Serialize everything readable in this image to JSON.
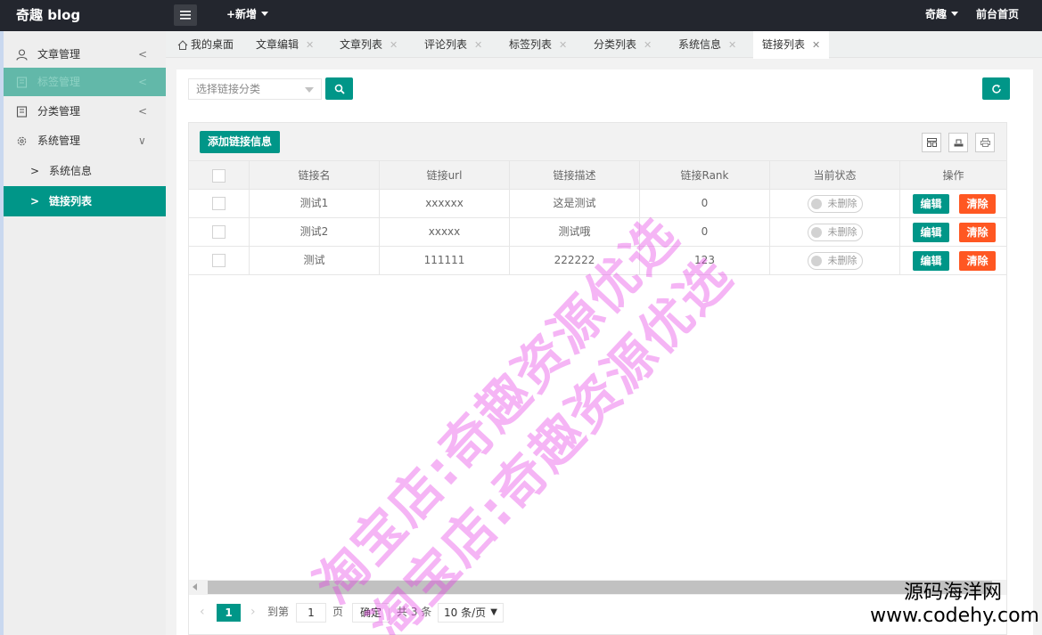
{
  "header": {
    "logo": "奇趣 blog",
    "add_new": "+新增",
    "user": "奇趣",
    "frontpage": "前台首页"
  },
  "sidebar": {
    "items": [
      {
        "label": "文章管理",
        "icon": "user-icon"
      },
      {
        "label": "标签管理",
        "icon": "book-icon"
      },
      {
        "label": "分类管理",
        "icon": "book-icon"
      },
      {
        "label": "系统管理",
        "icon": "gear-icon"
      }
    ],
    "sub_items": [
      {
        "label": "系统信息"
      },
      {
        "label": "链接列表"
      }
    ]
  },
  "tabs": [
    {
      "label": "我的桌面"
    },
    {
      "label": "文章编辑"
    },
    {
      "label": "文章列表"
    },
    {
      "label": "评论列表"
    },
    {
      "label": "标签列表"
    },
    {
      "label": "分类列表"
    },
    {
      "label": "系统信息"
    },
    {
      "label": "链接列表"
    }
  ],
  "filter": {
    "category_placeholder": "选择链接分类"
  },
  "toolbar": {
    "add_label": "添加链接信息"
  },
  "table": {
    "columns": [
      "链接名",
      "链接url",
      "链接描述",
      "链接Rank",
      "当前状态",
      "操作"
    ],
    "rows": [
      {
        "name": "测试1",
        "url": "xxxxxx",
        "desc": "这是测试",
        "rank": "0",
        "status": "未删除"
      },
      {
        "name": "测试2",
        "url": "xxxxx",
        "desc": "测试哦",
        "rank": "0",
        "status": "未删除"
      },
      {
        "name": "测试",
        "url": "111111",
        "desc": "222222",
        "rank": "123",
        "status": "未删除"
      }
    ],
    "edit_label": "编辑",
    "delete_label": "清除"
  },
  "pagination": {
    "current_page": "1",
    "goto_label": "到第",
    "page_input": "1",
    "page_unit": "页",
    "confirm_label": "确定",
    "total": "共 3 条",
    "page_size": "10 条/页"
  },
  "watermark": {
    "line1": "淘宝店:奇趣资源优选",
    "line2": "淘宝店:奇趣资源优选"
  },
  "corner_brand": {
    "line1": "源码海洋网",
    "line2": "www.codehy.com"
  },
  "colors": {
    "accent": "#009688",
    "danger": "#ff5722",
    "header_bg": "#23262e",
    "watermark": "#e63ce6"
  }
}
